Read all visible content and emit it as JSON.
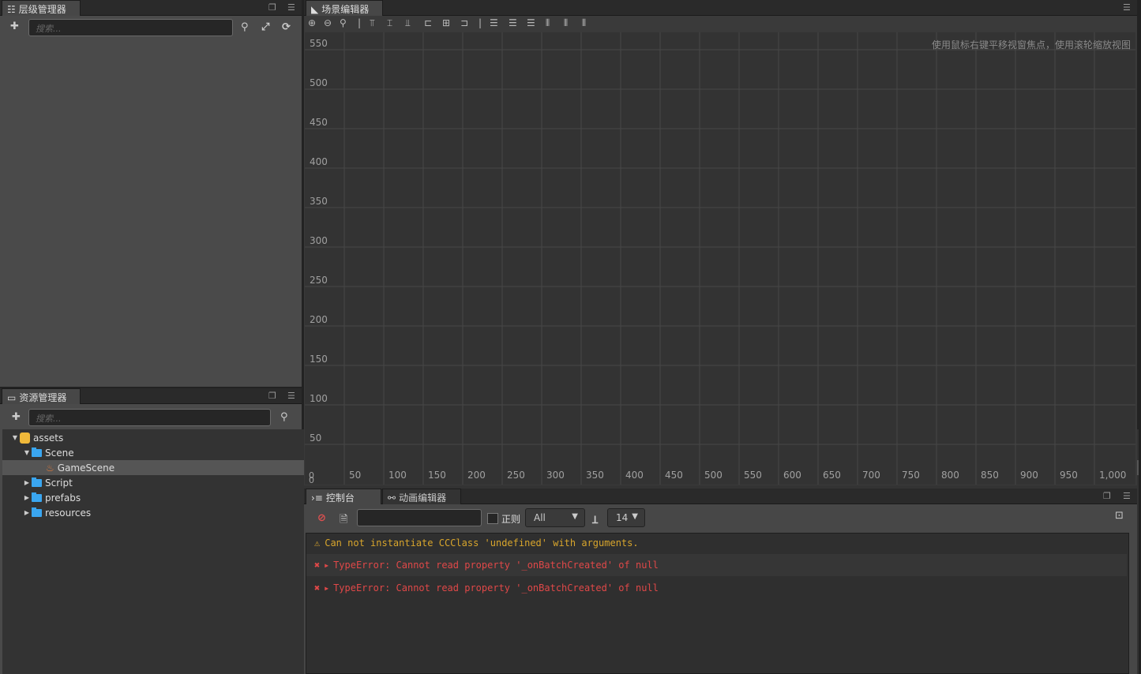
{
  "hierarchy": {
    "title": "层级管理器",
    "search_placeholder": "搜索..."
  },
  "assets": {
    "title": "资源管理器",
    "search_placeholder": "搜索...",
    "tree": [
      {
        "label": "assets",
        "type": "root",
        "expanded": true
      },
      {
        "label": "Scene",
        "type": "folder",
        "expanded": true
      },
      {
        "label": "GameScene",
        "type": "scene",
        "selected": true
      },
      {
        "label": "Script",
        "type": "folder",
        "expanded": false
      },
      {
        "label": "prefabs",
        "type": "folder",
        "expanded": false
      },
      {
        "label": "resources",
        "type": "folder",
        "expanded": false
      }
    ]
  },
  "scene": {
    "title": "场景编辑器",
    "hint": "使用鼠标右键平移视窗焦点，使用滚轮缩放视图",
    "x_ticks": [
      "50",
      "100",
      "150",
      "200",
      "250",
      "300",
      "350",
      "400",
      "450",
      "500",
      "550",
      "600",
      "650",
      "700",
      "750",
      "800",
      "850",
      "900",
      "950",
      "1,000"
    ],
    "y_ticks": [
      "50",
      "100",
      "150",
      "200",
      "250",
      "300",
      "350",
      "400",
      "450",
      "500",
      "550"
    ],
    "origin": "0"
  },
  "console": {
    "tab_console": "控制台",
    "tab_animation": "动画编辑器",
    "regex_label": "正则",
    "filter": "All",
    "font_size": "14",
    "messages": [
      {
        "level": "warning",
        "text": "Can not instantiate CCClass 'undefined' with arguments.",
        "color": "#d8a52c"
      },
      {
        "level": "error",
        "text": "TypeError: Cannot read property '_onBatchCreated' of null",
        "color": "#e04848"
      },
      {
        "level": "error",
        "text": "TypeError: Cannot read property '_onBatchCreated' of null",
        "color": "#e04848"
      }
    ]
  }
}
